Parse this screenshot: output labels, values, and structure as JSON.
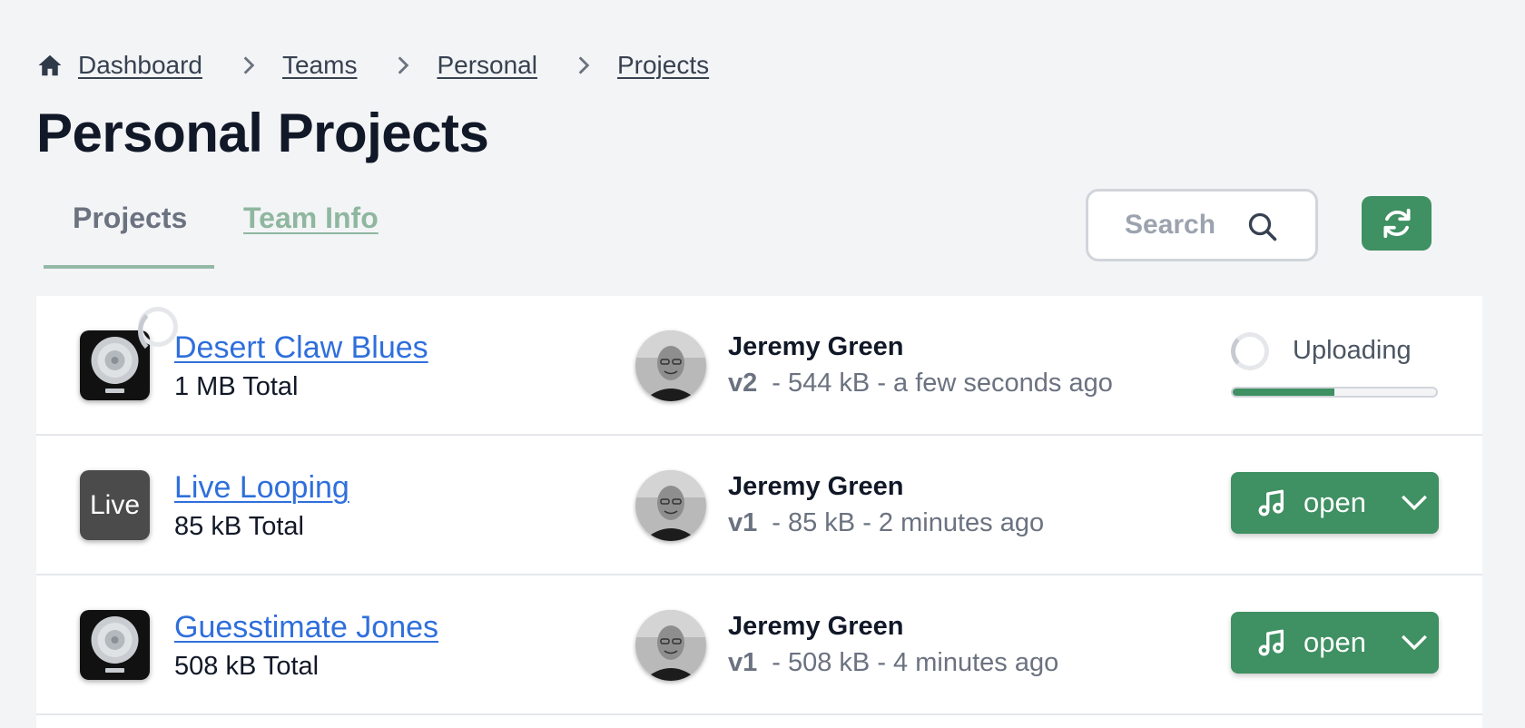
{
  "breadcrumb": {
    "home_icon": "home-icon",
    "items": [
      "Dashboard",
      "Teams",
      "Personal",
      "Projects"
    ]
  },
  "page": {
    "title": "Personal Projects"
  },
  "tabs": [
    {
      "label": "Projects",
      "active": true
    },
    {
      "label": "Team Info",
      "active": false
    }
  ],
  "search": {
    "placeholder": "Search",
    "value": ""
  },
  "toolbar": {
    "refresh_icon": "refresh-icon"
  },
  "colors": {
    "accent": "#3f9062",
    "link": "#2f6fdc",
    "tab_inactive": "#8fb7a0"
  },
  "projects": [
    {
      "name": "Desert Claw Blues",
      "total": "1 MB Total",
      "icon": "logic-pro-icon",
      "author": "Jeremy Green",
      "version": "v2",
      "details": "- 544 kB - a few seconds ago",
      "status": "Uploading",
      "progress": 0.5
    },
    {
      "name": "Live Looping",
      "total": "85 kB Total",
      "icon": "ableton-live-icon",
      "icon_text": "Live",
      "author": "Jeremy Green",
      "version": "v1",
      "details": "- 85 kB - 2 minutes ago",
      "action": "open"
    },
    {
      "name": "Guesstimate Jones",
      "total": "508 kB Total",
      "icon": "logic-pro-icon",
      "author": "Jeremy Green",
      "version": "v1",
      "details": "- 508 kB - 4 minutes ago",
      "action": "open"
    }
  ]
}
